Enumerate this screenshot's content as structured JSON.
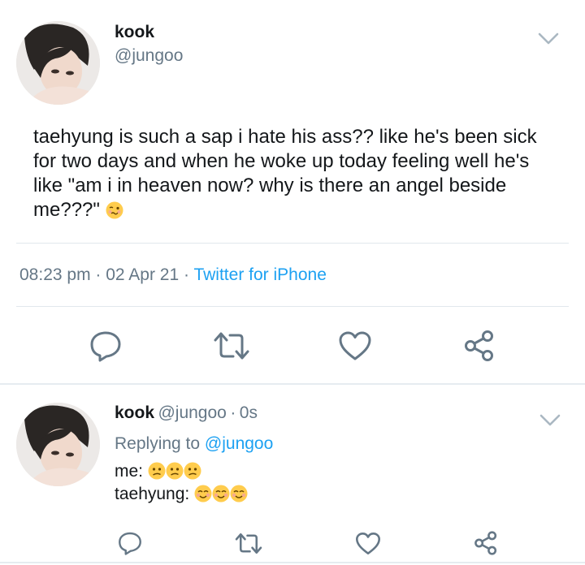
{
  "main_tweet": {
    "display_name": "kook",
    "handle": "@jungoo",
    "text": "taehyung is such a sap i hate his ass?? like he's been sick for two days and when he woke up today feeling well he's like \"am i in heaven now? why is there an angel beside me???\"",
    "time": "08:23 pm",
    "sep1": "·",
    "date": "02 Apr 21",
    "sep2": "·",
    "source": "Twitter for iPhone",
    "emoji": "woozy-face"
  },
  "actions": {
    "icons": [
      "reply-icon",
      "retweet-icon",
      "like-icon",
      "share-icon"
    ]
  },
  "reply_tweet": {
    "display_name": "kook",
    "handle": "@jungoo",
    "sep": "·",
    "time_ago": "0s",
    "replying_prefix": "Replying to",
    "replying_handle": "@jungoo",
    "line1_label": "me:",
    "line1_emojis": [
      "confused-face",
      "confused-face",
      "confused-face"
    ],
    "line2_label": "taehyung:",
    "line2_emojis": [
      "smiling-face",
      "smiling-face",
      "smiling-face"
    ]
  },
  "colors": {
    "accent": "#1da1f2",
    "secondary_text": "#657786",
    "icon": "#657786",
    "divider": "#e1e8ed"
  }
}
